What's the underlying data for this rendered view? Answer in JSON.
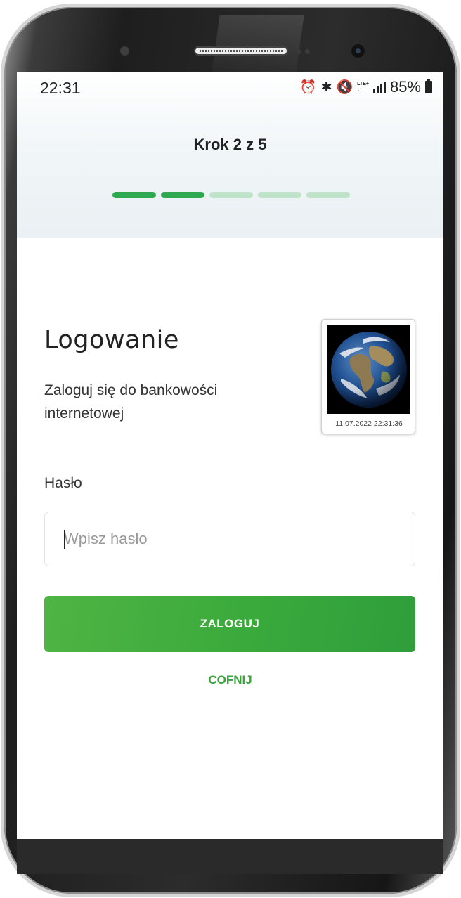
{
  "status_bar": {
    "time": "22:31",
    "network_badge_top": "LTE+",
    "network_badge_bottom": "↓↑",
    "battery_percent": "85%",
    "icons": [
      "alarm-icon",
      "bluetooth-icon",
      "mute-icon",
      "lte-icon",
      "signal-icon",
      "battery-icon"
    ]
  },
  "stepper": {
    "title": "Krok 2 z 5",
    "total_steps": 5,
    "current_step": 2,
    "active_color": "#2fa94f",
    "inactive_color": "#bfe3c8"
  },
  "login": {
    "title": "Logowanie",
    "subtitle": "Zaloguj się do bankowości internetowej"
  },
  "security_image": {
    "icon": "earth-image",
    "timestamp": "11.07.2022 22:31:36"
  },
  "password": {
    "label": "Hasło",
    "value": "",
    "placeholder": "Wpisz hasło"
  },
  "actions": {
    "login_label": "ZALOGUJ",
    "back_label": "COFNIJ",
    "accent_color": "#3aaa3c"
  }
}
